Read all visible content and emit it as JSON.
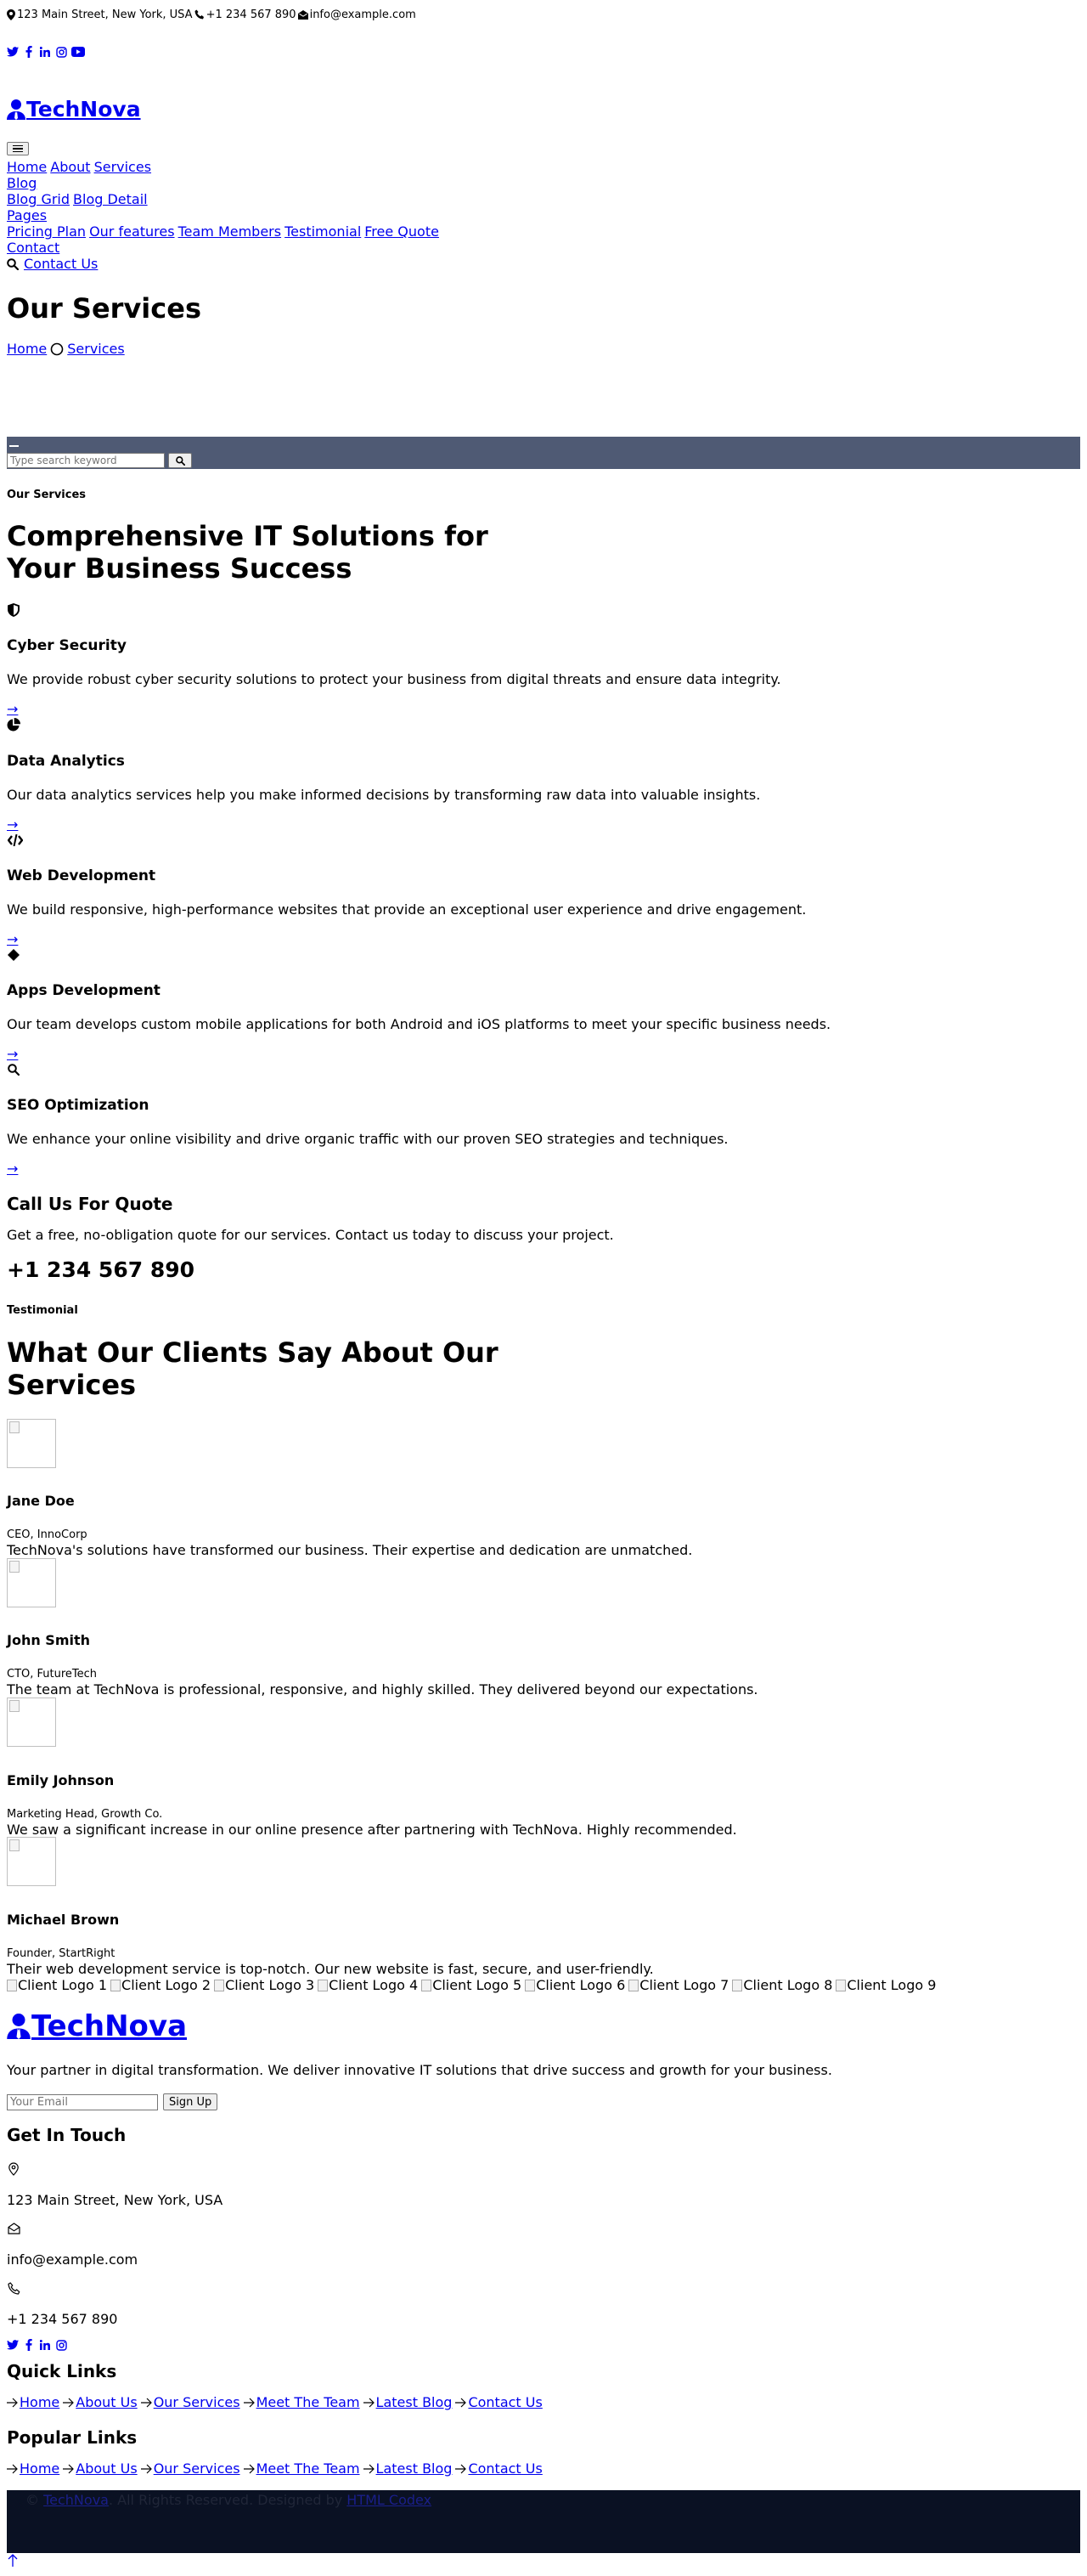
{
  "topbar": {
    "address": "123 Main Street, New York, USA",
    "phone": "+1 234 567 890",
    "email": "info@example.com"
  },
  "brand": {
    "name": "TechNova"
  },
  "nav": {
    "home": "Home",
    "about": "About",
    "services": "Services",
    "blog": "Blog",
    "blog_grid": "Blog Grid",
    "blog_detail": "Blog Detail",
    "pages": "Pages",
    "pricing": "Pricing Plan",
    "features": "Our features",
    "team": "Team Members",
    "testimonial": "Testimonial",
    "free_quote": "Free Quote",
    "contact": "Contact",
    "contact_us": "Contact Us"
  },
  "hero": {
    "title": "Our Services",
    "breadcrumb_home": "Home",
    "breadcrumb_current": "Services"
  },
  "search": {
    "placeholder": "Type search keyword"
  },
  "services": {
    "eyebrow": "Our Services",
    "title": "Comprehensive IT Solutions for Your Business Success",
    "items": [
      {
        "title": "Cyber Security",
        "desc": "We provide robust cyber security solutions to protect your business from digital threats and ensure data integrity.",
        "icon": "shield-icon",
        "arrow": "→"
      },
      {
        "title": "Data Analytics",
        "desc": "Our data analytics services help you make informed decisions by transforming raw data into valuable insights.",
        "icon": "pie-chart-icon",
        "arrow": "→"
      },
      {
        "title": "Web Development",
        "desc": "We build responsive, high-performance websites that provide an exceptional user experience and drive engagement.",
        "icon": "code-icon",
        "arrow": "→"
      },
      {
        "title": "Apps Development",
        "desc": "Our team develops custom mobile applications for both Android and iOS platforms to meet your specific business needs.",
        "icon": "diamond-icon",
        "arrow": "→"
      },
      {
        "title": "SEO Optimization",
        "desc": "We enhance your online visibility and drive organic traffic with our proven SEO strategies and techniques.",
        "icon": "search-icon",
        "arrow": "→"
      }
    ],
    "quote_title": "Call Us For Quote",
    "quote_desc": "Get a free, no-obligation quote for our services. Contact us today to discuss your project.",
    "quote_phone": "+1 234 567 890"
  },
  "testimonials": {
    "eyebrow": "Testimonial",
    "title": "What Our Clients Say About Our Services",
    "items": [
      {
        "name": "Jane Doe",
        "role": "CEO, InnoCorp",
        "text": "TechNova's solutions have transformed our business. Their expertise and dedication are unmatched."
      },
      {
        "name": "John Smith",
        "role": "CTO, FutureTech",
        "text": "The team at TechNova is professional, responsive, and highly skilled. They delivered beyond our expectations."
      },
      {
        "name": "Emily Johnson",
        "role": "Marketing Head, Growth Co.",
        "text": "We saw a significant increase in our online presence after partnering with TechNova. Highly recommended."
      },
      {
        "name": "Michael Brown",
        "role": "Founder, StartRight",
        "text": "Their web development service is top-notch. Our new website is fast, secure, and user-friendly."
      }
    ]
  },
  "clients": [
    "Client Logo 1",
    "Client Logo 2",
    "Client Logo 3",
    "Client Logo 4",
    "Client Logo 5",
    "Client Logo 6",
    "Client Logo 7",
    "Client Logo 8",
    "Client Logo 9"
  ],
  "footer": {
    "desc": "Your partner in digital transformation. We deliver innovative IT solutions that drive success and growth for your business.",
    "newsletter_placeholder": "Your Email",
    "newsletter_button": "Sign Up",
    "touch_title": "Get In Touch",
    "address": "123 Main Street, New York, USA",
    "email": "info@example.com",
    "phone": "+1 234 567 890",
    "quick_title": "Quick Links",
    "popular_title": "Popular Links",
    "links": [
      "Home",
      "About Us",
      "Our Services",
      "Meet The Team",
      "Latest Blog",
      "Contact Us"
    ],
    "copyright_brand": "TechNova",
    "copyright_text": ". All Rights Reserved. Designed by ",
    "designer": "HTML Codex"
  },
  "colors": {
    "search_strip": "#4f5a74",
    "copyright_bar": "#0a1123",
    "link": "#0000ee"
  }
}
